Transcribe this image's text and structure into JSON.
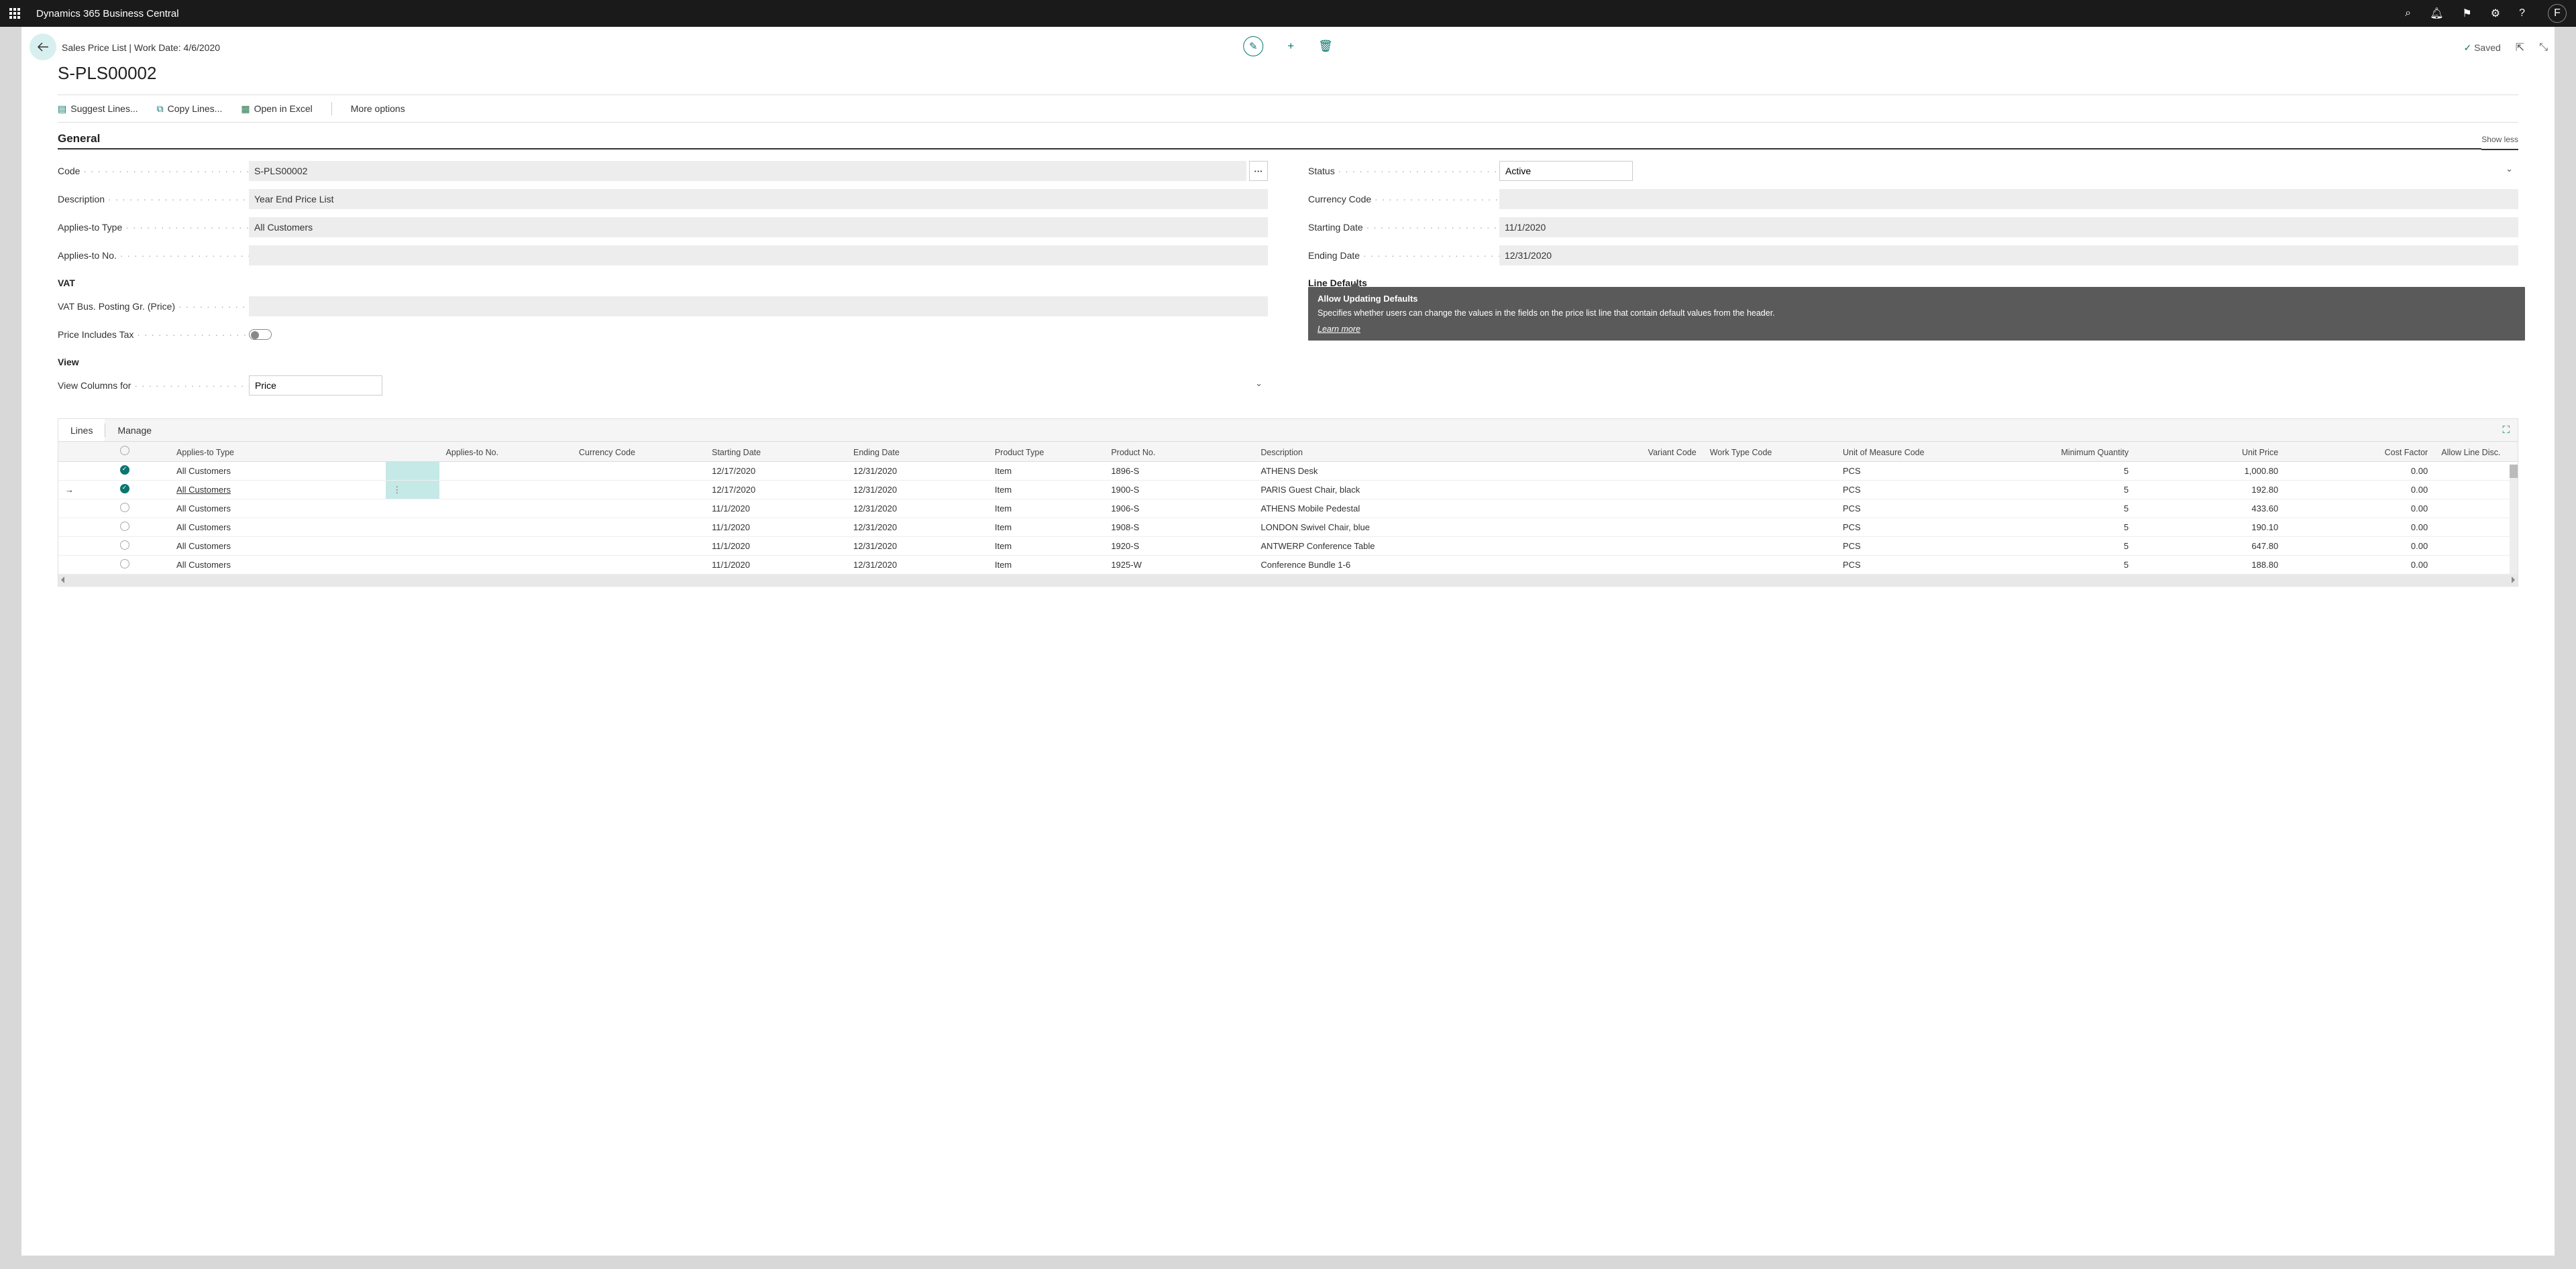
{
  "app_title": "Dynamics 365 Business Central",
  "avatar_initial": "F",
  "breadcrumb": "Sales Price List | Work Date: 4/6/2020",
  "page_title": "S-PLS00002",
  "saved_label": "Saved",
  "toolbar": {
    "suggest": "Suggest Lines...",
    "copy": "Copy Lines...",
    "excel": "Open in Excel",
    "more": "More options"
  },
  "section_general": "General",
  "show_less": "Show less",
  "fields": {
    "code_label": "Code",
    "code_value": "S-PLS00002",
    "description_label": "Description",
    "description_value": "Year End Price List",
    "applies_type_label": "Applies-to Type",
    "applies_type_value": "All Customers",
    "applies_no_label": "Applies-to No.",
    "applies_no_value": "",
    "vat_head": "VAT",
    "vat_posting_label": "VAT Bus. Posting Gr. (Price)",
    "vat_posting_value": "",
    "price_incl_tax_label": "Price Includes Tax",
    "view_head": "View",
    "view_columns_label": "View Columns for",
    "view_columns_value": "Price",
    "status_label": "Status",
    "status_value": "Active",
    "currency_label": "Currency Code",
    "currency_value": "",
    "start_label": "Starting Date",
    "start_value": "11/1/2020",
    "end_label": "Ending Date",
    "end_value": "12/31/2020",
    "line_defaults_head": "Line Defaults",
    "allow_updating_label": "Allow Updating Defaults"
  },
  "tooltip": {
    "title": "Allow Updating Defaults",
    "body": "Specifies whether users can change the values in the fields on the price list line that contain default values from the header.",
    "link": "Learn more"
  },
  "lines": {
    "tab_lines": "Lines",
    "tab_manage": "Manage",
    "columns": {
      "applies_type": "Applies-to Type",
      "applies_no": "Applies-to No.",
      "currency": "Currency Code",
      "start": "Starting Date",
      "end": "Ending Date",
      "ptype": "Product Type",
      "pno": "Product No.",
      "desc": "Description",
      "variant": "Variant Code",
      "worktype": "Work Type Code",
      "uom": "Unit of Measure Code",
      "minqty": "Minimum Quantity",
      "uprice": "Unit Price",
      "cfactor": "Cost Factor",
      "allowdisc": "Allow Line Disc."
    },
    "rows": [
      {
        "checked": true,
        "active": false,
        "highlight": true,
        "applies_type": "All Customers",
        "start": "12/17/2020",
        "end": "12/31/2020",
        "ptype": "Item",
        "pno": "1896-S",
        "desc": "ATHENS Desk",
        "uom": "PCS",
        "minqty": "5",
        "uprice": "1,000.80",
        "cfactor": "0.00"
      },
      {
        "checked": true,
        "active": true,
        "highlight": true,
        "applies_type": "All Customers",
        "start": "12/17/2020",
        "end": "12/31/2020",
        "ptype": "Item",
        "pno": "1900-S",
        "desc": "PARIS Guest Chair, black",
        "uom": "PCS",
        "minqty": "5",
        "uprice": "192.80",
        "cfactor": "0.00"
      },
      {
        "checked": false,
        "active": false,
        "highlight": false,
        "applies_type": "All Customers",
        "start": "11/1/2020",
        "end": "12/31/2020",
        "ptype": "Item",
        "pno": "1906-S",
        "desc": "ATHENS Mobile Pedestal",
        "uom": "PCS",
        "minqty": "5",
        "uprice": "433.60",
        "cfactor": "0.00"
      },
      {
        "checked": false,
        "active": false,
        "highlight": false,
        "applies_type": "All Customers",
        "start": "11/1/2020",
        "end": "12/31/2020",
        "ptype": "Item",
        "pno": "1908-S",
        "desc": "LONDON Swivel Chair, blue",
        "uom": "PCS",
        "minqty": "5",
        "uprice": "190.10",
        "cfactor": "0.00"
      },
      {
        "checked": false,
        "active": false,
        "highlight": false,
        "applies_type": "All Customers",
        "start": "11/1/2020",
        "end": "12/31/2020",
        "ptype": "Item",
        "pno": "1920-S",
        "desc": "ANTWERP Conference Table",
        "uom": "PCS",
        "minqty": "5",
        "uprice": "647.80",
        "cfactor": "0.00"
      },
      {
        "checked": false,
        "active": false,
        "highlight": false,
        "applies_type": "All Customers",
        "start": "11/1/2020",
        "end": "12/31/2020",
        "ptype": "Item",
        "pno": "1925-W",
        "desc": "Conference Bundle 1-6",
        "uom": "PCS",
        "minqty": "5",
        "uprice": "188.80",
        "cfactor": "0.00"
      }
    ]
  }
}
